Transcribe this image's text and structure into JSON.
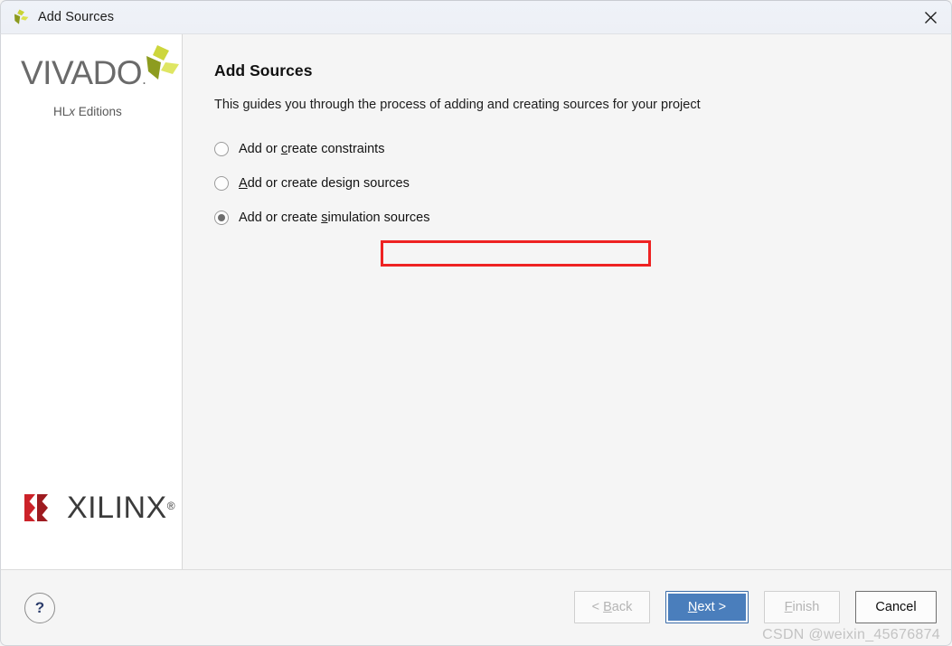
{
  "window": {
    "title": "Add Sources",
    "app_icon": "vivado-logo-icon",
    "close_icon": "close-icon"
  },
  "sidebar": {
    "vivado": {
      "wordmark": "VIVADO",
      "trademark_dot": ".",
      "subtitle_prefix": "HL",
      "subtitle_italic": "x",
      "subtitle_suffix": " Editions",
      "mark_icon": "vivado-pinwheel-icon",
      "mark_colors": {
        "light": "#d4dd3a",
        "mid": "#c3cf3c",
        "dark": "#8a9a20"
      }
    },
    "xilinx": {
      "wordmark": "XILINX",
      "registered": "®",
      "mark_icon": "xilinx-x-icon",
      "mark_color": "#cc2229",
      "word_color": "#3b3b3b"
    }
  },
  "main": {
    "title": "Add Sources",
    "subtitle": "This guides you through the process of adding and creating sources for your project",
    "options": [
      {
        "id": "constraints",
        "pre": "Add or ",
        "mnemonic": "c",
        "post": "reate constraints",
        "selected": false
      },
      {
        "id": "design-sources",
        "pre": "",
        "mnemonic": "A",
        "post": "dd or create design sources",
        "selected": false
      },
      {
        "id": "simulation-sources",
        "pre": "Add or create ",
        "mnemonic": "s",
        "post": "imulation sources",
        "selected": true
      }
    ],
    "annotation": {
      "target": "simulation-sources",
      "color": "#ee2222"
    }
  },
  "footer": {
    "help_label": "?",
    "buttons": [
      {
        "id": "back",
        "pre": "< ",
        "mnemonic": "B",
        "post": "ack",
        "state": "disabled"
      },
      {
        "id": "next",
        "pre": "",
        "mnemonic": "N",
        "post": "ext >",
        "state": "primary"
      },
      {
        "id": "finish",
        "pre": "",
        "mnemonic": "F",
        "post": "inish",
        "state": "disabled"
      },
      {
        "id": "cancel",
        "pre": "Cancel",
        "mnemonic": "",
        "post": "",
        "state": "normal"
      }
    ]
  },
  "watermark": "CSDN @weixin_45676874",
  "colors": {
    "titlebar": "#eff2f8",
    "content_bg": "#f5f5f5",
    "sidebar_bg": "#ffffff",
    "primary_button": "#4a7ebc",
    "annotation": "#ee2222"
  }
}
